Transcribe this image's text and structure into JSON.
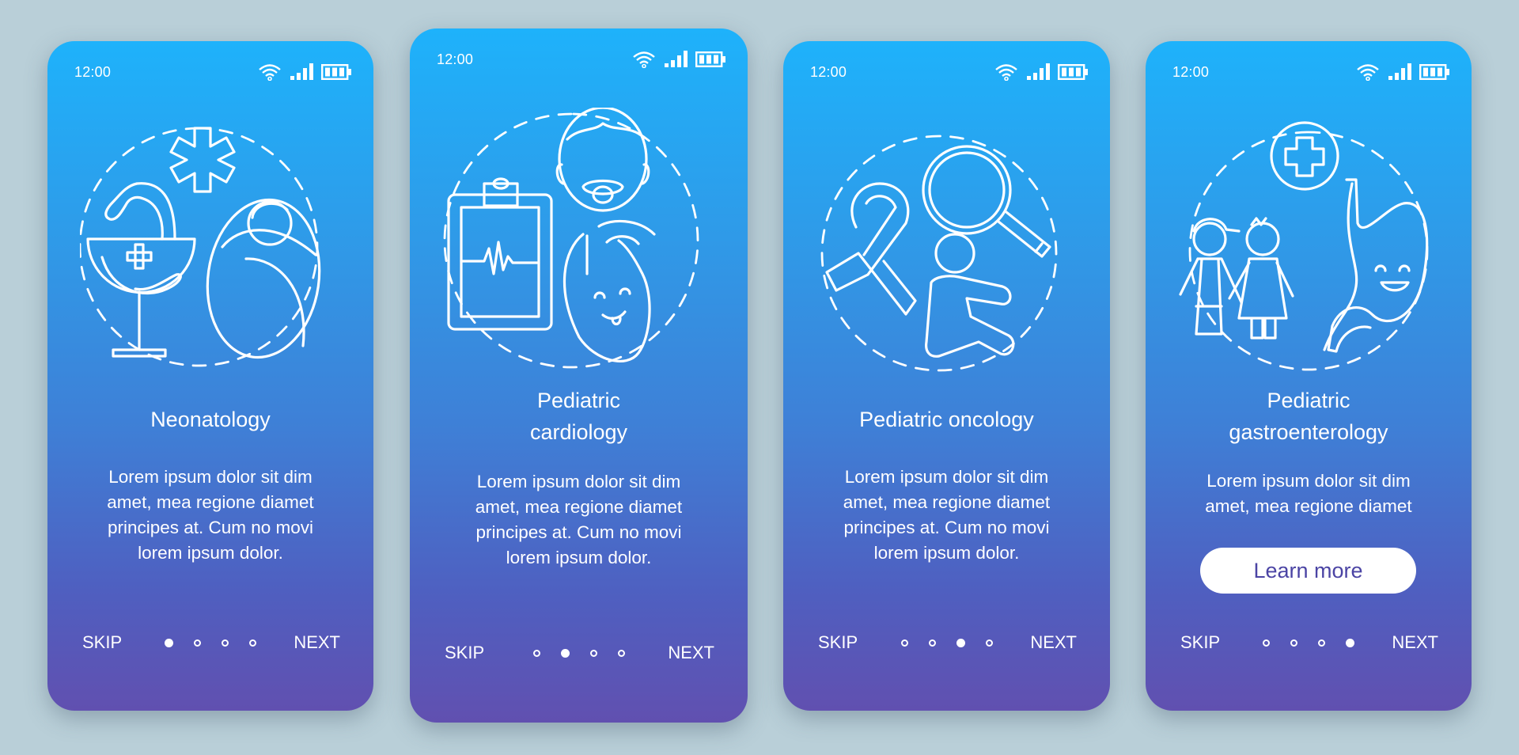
{
  "status_bar": {
    "time": "12:00",
    "icons": [
      "wifi-icon",
      "signal-icon",
      "battery-icon"
    ]
  },
  "colors": {
    "background": "#b9cfd8",
    "gradient_top": "#1eb2fb",
    "gradient_bottom": "#6150b0",
    "button_text": "#4b44a4"
  },
  "screens": [
    {
      "title": "Neonatology",
      "body_lines": [
        "Lorem ipsum dolor sit dim",
        "amet, mea regione diamet",
        "principes at. Cum no movi",
        "lorem ipsum dolor."
      ],
      "illustration": [
        "bowl-of-hygieia-icon",
        "star-of-life-icon",
        "swaddled-baby-icon"
      ],
      "skip_label": "SKIP",
      "next_label": "NEXT",
      "active_page": 1,
      "page_count": 4
    },
    {
      "title_lines": [
        "Pediatric",
        "cardiology"
      ],
      "body_lines": [
        "Lorem ipsum dolor sit dim",
        "amet, mea regione diamet",
        "principes at. Cum no movi",
        "lorem ipsum dolor."
      ],
      "illustration": [
        "ecg-clipboard-icon",
        "baby-with-pacifier-icon",
        "smiling-heart-icon"
      ],
      "skip_label": "SKIP",
      "next_label": "NEXT",
      "active_page": 2,
      "page_count": 4
    },
    {
      "title": "Pediatric oncology",
      "body_lines": [
        "Lorem ipsum dolor sit dim",
        "amet, mea regione diamet",
        "principes at. Cum no movi",
        "lorem ipsum dolor."
      ],
      "illustration": [
        "awareness-ribbon-icon",
        "magnifier-icon",
        "sitting-child-icon"
      ],
      "skip_label": "SKIP",
      "next_label": "NEXT",
      "active_page": 3,
      "page_count": 4
    },
    {
      "title_lines": [
        "Pediatric",
        "gastroenterology"
      ],
      "body_lines": [
        "Lorem ipsum dolor sit dim",
        "amet, mea regione diamet"
      ],
      "button_label": "Learn more",
      "illustration": [
        "medical-cross-circle-icon",
        "boy-and-girl-icon",
        "smiling-stomach-icon"
      ],
      "skip_label": "SKIP",
      "next_label": "NEXT",
      "active_page": 4,
      "page_count": 4
    }
  ]
}
